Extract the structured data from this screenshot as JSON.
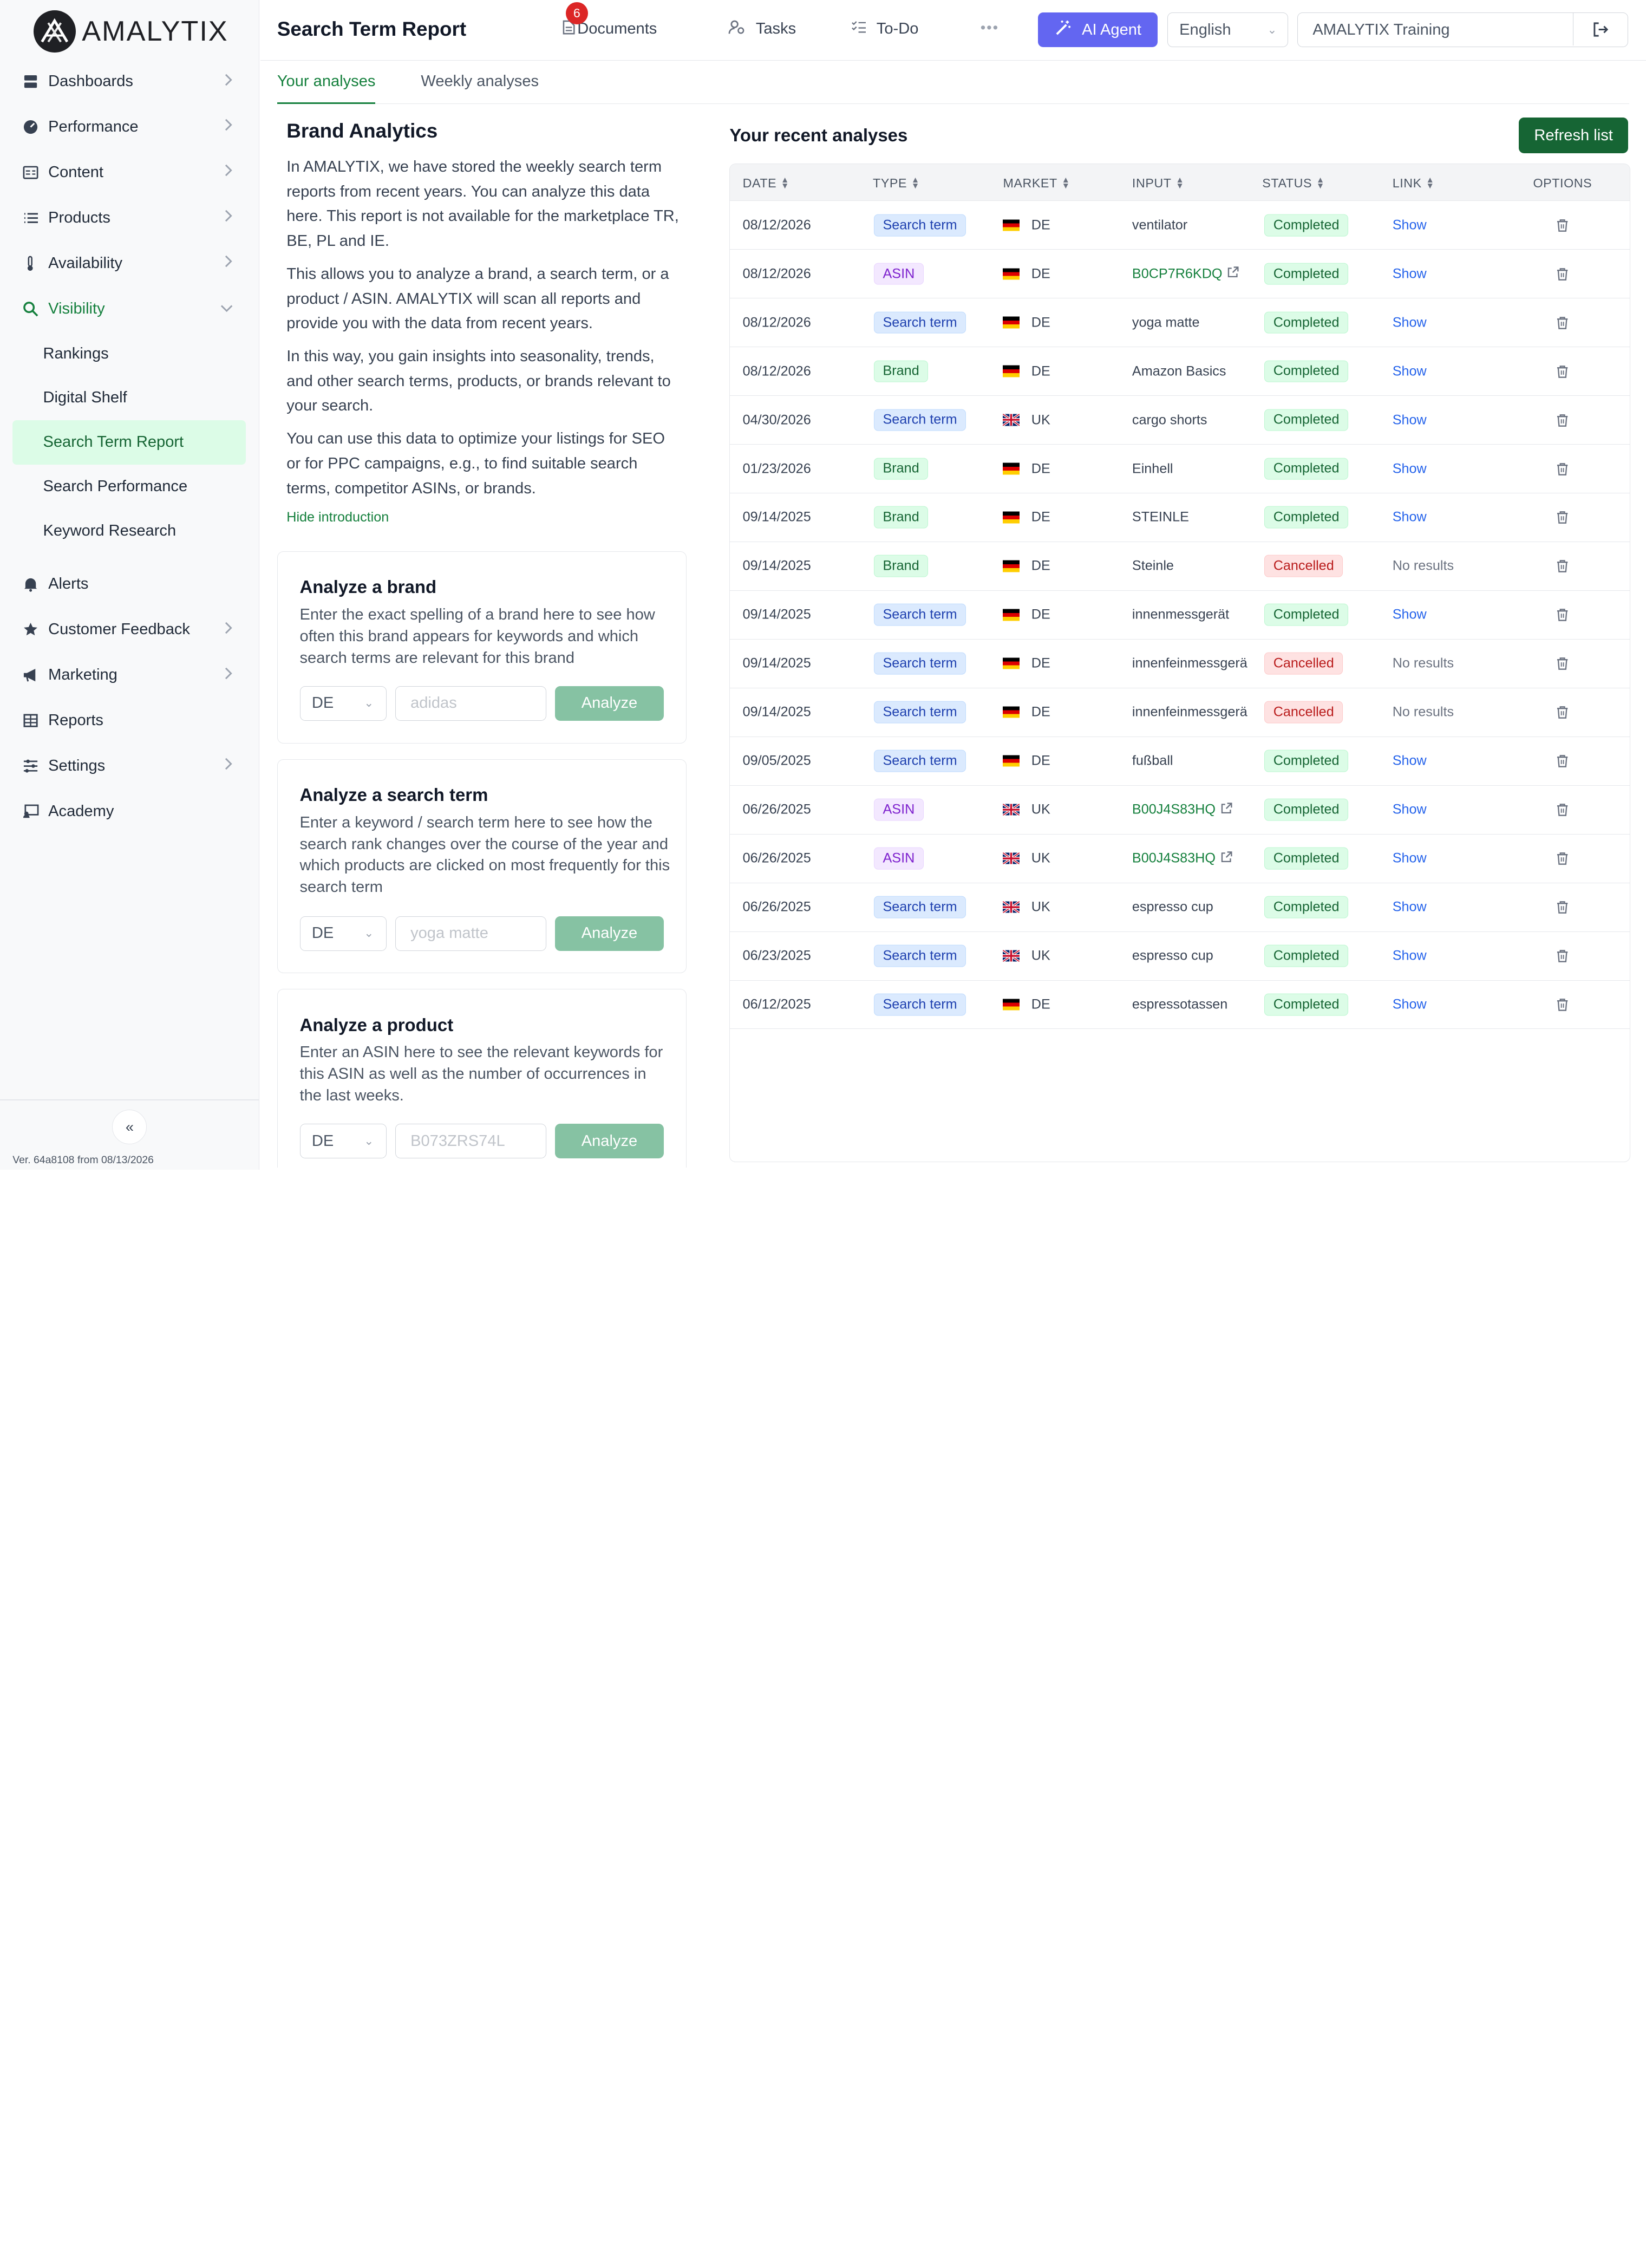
{
  "brand": {
    "name": "AMALYTIX"
  },
  "sidebar": {
    "items": [
      {
        "label": "Dashboards",
        "icon": "dashboard-icon",
        "chevron": true
      },
      {
        "label": "Performance",
        "icon": "gauge-icon",
        "chevron": true
      },
      {
        "label": "Content",
        "icon": "content-icon",
        "chevron": true
      },
      {
        "label": "Products",
        "icon": "list-icon",
        "chevron": true
      },
      {
        "label": "Availability",
        "icon": "thermometer-icon",
        "chevron": true
      },
      {
        "label": "Visibility",
        "icon": "search-icon",
        "chevron": true,
        "open": true
      }
    ],
    "sub_items": [
      {
        "label": "Rankings"
      },
      {
        "label": "Digital Shelf"
      },
      {
        "label": "Search Term Report",
        "active": true
      },
      {
        "label": "Search Performance"
      },
      {
        "label": "Keyword Research"
      }
    ],
    "items_after": [
      {
        "label": "Alerts",
        "icon": "bell-icon",
        "chevron": false
      },
      {
        "label": "Customer Feedback",
        "icon": "star-icon",
        "chevron": true
      },
      {
        "label": "Marketing",
        "icon": "megaphone-icon",
        "chevron": true
      },
      {
        "label": "Reports",
        "icon": "table-icon",
        "chevron": false
      },
      {
        "label": "Settings",
        "icon": "sliders-icon",
        "chevron": true
      },
      {
        "label": "Academy",
        "icon": "academy-icon",
        "chevron": false
      }
    ],
    "version": "Ver. 64a8108 from 08/13/2026"
  },
  "header": {
    "title": "Search Term Report",
    "documents_label": "Documents",
    "documents_badge": "6",
    "tasks_label": "Tasks",
    "todo_label": "To-Do",
    "ai_agent_label": "AI Agent",
    "language": "English",
    "account": "AMALYTIX Training"
  },
  "tabs": [
    {
      "label": "Your analyses",
      "active": true
    },
    {
      "label": "Weekly analyses",
      "active": false
    }
  ],
  "intro": {
    "title": "Brand Analytics",
    "paragraphs": [
      "In AMALYTIX, we have stored the weekly search term reports from recent years. You can analyze this data here. This report is not available for the marketplace TR, BE, PL and IE.",
      "This allows you to analyze a brand, a search term, or a product / ASIN. AMALYTIX will scan all reports and provide you with the data from recent years.",
      "In this way, you gain insights into seasonality, trends, and other search terms, products, or brands relevant to your search.",
      "You can use this data to optimize your listings for SEO or for PPC campaigns, e.g., to find suitable search terms, competitor ASINs, or brands."
    ],
    "hide_link": "Hide introduction"
  },
  "cards": [
    {
      "title": "Analyze a brand",
      "desc": "Enter the exact spelling of a brand here to see how often this brand appears for keywords and which search terms are relevant for this brand",
      "market": "DE",
      "placeholder": "adidas",
      "button": "Analyze"
    },
    {
      "title": "Analyze a search term",
      "desc": "Enter a keyword / search term here to see how the search rank changes over the course of the year and which products are clicked on most frequently for this search term",
      "market": "DE",
      "placeholder": "yoga matte",
      "button": "Analyze"
    },
    {
      "title": "Analyze a product",
      "desc": "Enter an ASIN here to see the relevant keywords for this ASIN as well as the number of occurrences in the last weeks.",
      "market": "DE",
      "placeholder": "B073ZRS74L",
      "button": "Analyze"
    }
  ],
  "recent": {
    "title": "Your recent analyses",
    "refresh_label": "Refresh list",
    "columns": [
      "DATE",
      "TYPE",
      "MARKET",
      "INPUT",
      "STATUS",
      "LINK",
      "OPTIONS"
    ],
    "rows": [
      {
        "date": "08/12/2026",
        "type": "Search term",
        "market": "DE",
        "input": "ventilator",
        "status": "Completed",
        "link": "Show"
      },
      {
        "date": "08/12/2026",
        "type": "ASIN",
        "market": "DE",
        "input": "B0CP7R6KDQ",
        "status": "Completed",
        "link": "Show"
      },
      {
        "date": "08/12/2026",
        "type": "Search term",
        "market": "DE",
        "input": "yoga matte",
        "status": "Completed",
        "link": "Show"
      },
      {
        "date": "08/12/2026",
        "type": "Brand",
        "market": "DE",
        "input": "Amazon Basics",
        "status": "Completed",
        "link": "Show"
      },
      {
        "date": "04/30/2026",
        "type": "Search term",
        "market": "UK",
        "input": "cargo shorts",
        "status": "Completed",
        "link": "Show"
      },
      {
        "date": "01/23/2026",
        "type": "Brand",
        "market": "DE",
        "input": "Einhell",
        "status": "Completed",
        "link": "Show"
      },
      {
        "date": "09/14/2025",
        "type": "Brand",
        "market": "DE",
        "input": "STEINLE",
        "status": "Completed",
        "link": "Show"
      },
      {
        "date": "09/14/2025",
        "type": "Brand",
        "market": "DE",
        "input": "Steinle",
        "status": "Cancelled",
        "link": "No results"
      },
      {
        "date": "09/14/2025",
        "type": "Search term",
        "market": "DE",
        "input": "innenmessgerät",
        "status": "Completed",
        "link": "Show"
      },
      {
        "date": "09/14/2025",
        "type": "Search term",
        "market": "DE",
        "input": "innenfeinmessgerä",
        "status": "Cancelled",
        "link": "No results"
      },
      {
        "date": "09/14/2025",
        "type": "Search term",
        "market": "DE",
        "input": "innenfeinmessgerä",
        "status": "Cancelled",
        "link": "No results"
      },
      {
        "date": "09/05/2025",
        "type": "Search term",
        "market": "DE",
        "input": "fußball",
        "status": "Completed",
        "link": "Show"
      },
      {
        "date": "06/26/2025",
        "type": "ASIN",
        "market": "UK",
        "input": "B00J4S83HQ",
        "status": "Completed",
        "link": "Show"
      },
      {
        "date": "06/26/2025",
        "type": "ASIN",
        "market": "UK",
        "input": "B00J4S83HQ",
        "status": "Completed",
        "link": "Show"
      },
      {
        "date": "06/26/2025",
        "type": "Search term",
        "market": "UK",
        "input": "espresso cup",
        "status": "Completed",
        "link": "Show"
      },
      {
        "date": "06/23/2025",
        "type": "Search term",
        "market": "UK",
        "input": "espresso cup",
        "status": "Completed",
        "link": "Show"
      },
      {
        "date": "06/12/2025",
        "type": "Search term",
        "market": "DE",
        "input": "espressotassen",
        "status": "Completed",
        "link": "Show"
      }
    ]
  },
  "colors": {
    "accent": "#15803d",
    "ai": "#6366f1",
    "refresh": "#166534"
  }
}
